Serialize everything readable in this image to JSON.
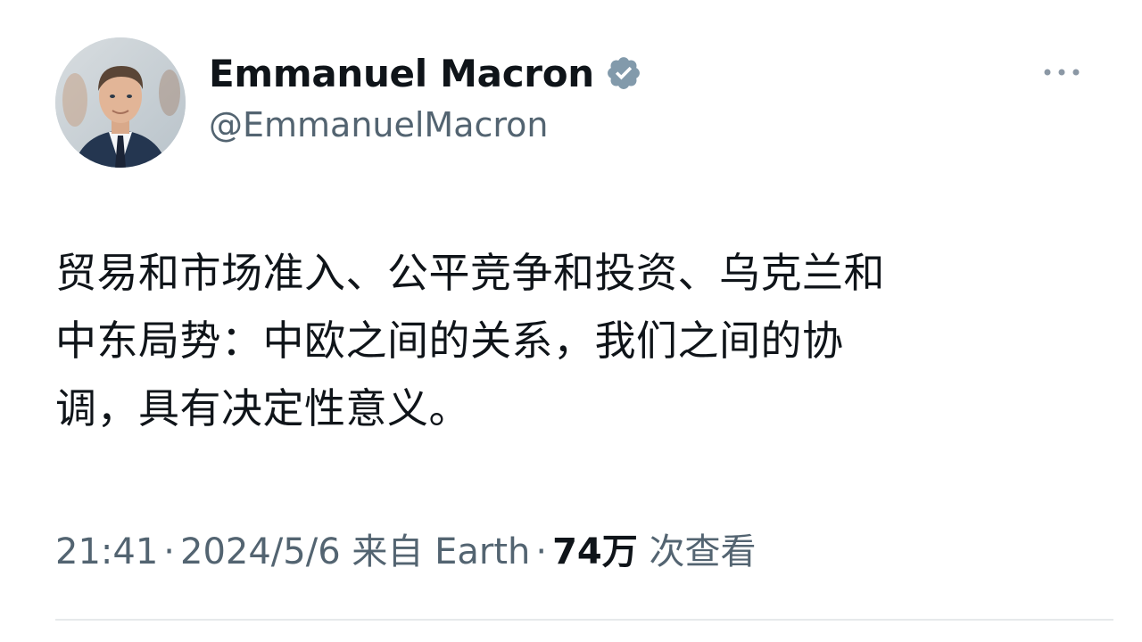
{
  "author": {
    "display_name": "Emmanuel Macron",
    "handle": "@EmmanuelMacron",
    "verified": true,
    "avatar_icon": "profile-photo",
    "verified_color": "#829aab"
  },
  "tweet": {
    "lines": [
      "贸易和市场准入、公平竞争和投资、乌克兰和",
      "中东局势：中欧之间的关系，我们之间的协",
      "调，具有决定性意义。"
    ]
  },
  "meta": {
    "time": "21:41",
    "separator": "·",
    "date": "2024/5/6",
    "source_prefix": "来自",
    "source": "Earth",
    "views_count": "74万",
    "views_label": "次查看"
  },
  "colors": {
    "text_primary": "#0f1419",
    "text_secondary": "#536471",
    "divider": "#e6e9eb"
  }
}
